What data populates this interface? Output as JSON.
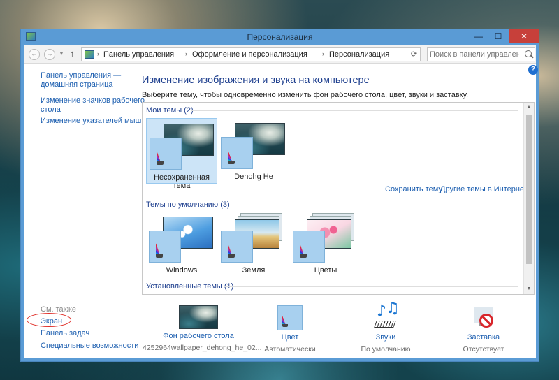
{
  "window": {
    "title": "Персонализация",
    "controls": {
      "minimize": "—",
      "maximize": "☐",
      "close": "✕"
    }
  },
  "addressbar": {
    "crumbs": [
      "Панель управления",
      "Оформление и персонализация",
      "Персонализация"
    ],
    "separator": "›",
    "search_placeholder": "Поиск в панели управления"
  },
  "sidebar": {
    "links": [
      {
        "label": "Панель управления —\nдомашняя страница"
      },
      {
        "label": "Изменение значков рабочего\nстола"
      },
      {
        "label": "Изменение указателей мыши"
      }
    ],
    "see_also_heading": "См. также",
    "see_also": [
      {
        "label": "Экран"
      },
      {
        "label": "Панель задач"
      },
      {
        "label": "Специальные возможности"
      }
    ]
  },
  "main": {
    "title": "Изменение изображения и звука на компьютере",
    "subtitle": "Выберите тему, чтобы одновременно изменить фон рабочего стола, цвет, звуки и заставку.",
    "groups": {
      "my_themes": "Мои темы (2)",
      "default_themes": "Темы по умолчанию (3)",
      "installed_themes": "Установленные темы (1)"
    },
    "my_themes": [
      {
        "label": "Несохраненная тема",
        "selected": true
      },
      {
        "label": "Dehohg He",
        "selected": false
      }
    ],
    "default_themes": [
      {
        "label": "Windows"
      },
      {
        "label": "Земля"
      },
      {
        "label": "Цветы"
      }
    ],
    "links": {
      "save_theme": "Сохранить тему",
      "more_themes": "Другие темы в Интернете"
    }
  },
  "bottom": {
    "items": [
      {
        "label": "Фон рабочего стола",
        "value": "4252964wallpaper_dehong_he_02..."
      },
      {
        "label": "Цвет",
        "value": "Автоматически"
      },
      {
        "label": "Звуки",
        "value": "По умолчанию"
      },
      {
        "label": "Заставка",
        "value": "Отсутствует"
      }
    ]
  },
  "colors": {
    "titlebar": "#5a9bd5",
    "link": "#1d5fb0",
    "heading": "#1e3f8e",
    "highlight_circle": "#e0302a",
    "selected_tile": "#cce4f7"
  }
}
